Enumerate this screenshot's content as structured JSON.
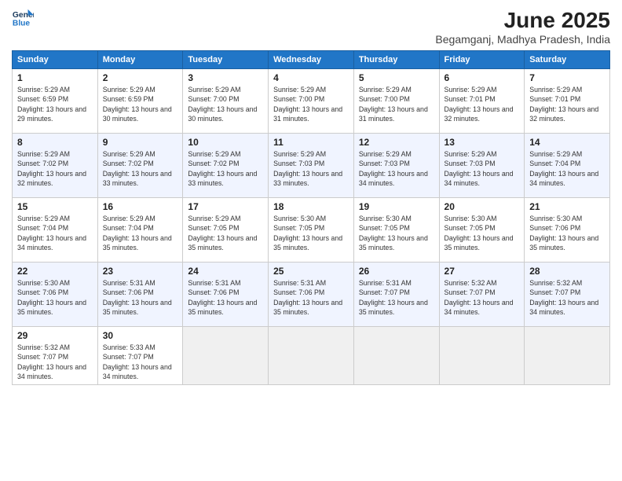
{
  "logo": {
    "line1": "General",
    "line2": "Blue"
  },
  "title": "June 2025",
  "subtitle": "Begamganj, Madhya Pradesh, India",
  "days_of_week": [
    "Sunday",
    "Monday",
    "Tuesday",
    "Wednesday",
    "Thursday",
    "Friday",
    "Saturday"
  ],
  "cells": [
    {
      "day": "",
      "empty": true
    },
    {
      "day": "",
      "empty": true
    },
    {
      "day": "",
      "empty": true
    },
    {
      "day": "",
      "empty": true
    },
    {
      "day": "",
      "empty": true
    },
    {
      "day": "",
      "empty": true
    },
    {
      "day": "7",
      "sunrise": "5:29 AM",
      "sunset": "7:01 PM",
      "daylight": "13 hours and 32 minutes."
    },
    {
      "day": "1",
      "sunrise": "5:29 AM",
      "sunset": "6:59 PM",
      "daylight": "13 hours and 29 minutes."
    },
    {
      "day": "2",
      "sunrise": "5:29 AM",
      "sunset": "6:59 PM",
      "daylight": "13 hours and 30 minutes."
    },
    {
      "day": "3",
      "sunrise": "5:29 AM",
      "sunset": "7:00 PM",
      "daylight": "13 hours and 30 minutes."
    },
    {
      "day": "4",
      "sunrise": "5:29 AM",
      "sunset": "7:00 PM",
      "daylight": "13 hours and 31 minutes."
    },
    {
      "day": "5",
      "sunrise": "5:29 AM",
      "sunset": "7:00 PM",
      "daylight": "13 hours and 31 minutes."
    },
    {
      "day": "6",
      "sunrise": "5:29 AM",
      "sunset": "7:01 PM",
      "daylight": "13 hours and 32 minutes."
    },
    {
      "day": "7",
      "sunrise": "5:29 AM",
      "sunset": "7:01 PM",
      "daylight": "13 hours and 32 minutes."
    },
    {
      "day": "8",
      "sunrise": "5:29 AM",
      "sunset": "7:02 PM",
      "daylight": "13 hours and 32 minutes."
    },
    {
      "day": "9",
      "sunrise": "5:29 AM",
      "sunset": "7:02 PM",
      "daylight": "13 hours and 33 minutes."
    },
    {
      "day": "10",
      "sunrise": "5:29 AM",
      "sunset": "7:02 PM",
      "daylight": "13 hours and 33 minutes."
    },
    {
      "day": "11",
      "sunrise": "5:29 AM",
      "sunset": "7:03 PM",
      "daylight": "13 hours and 33 minutes."
    },
    {
      "day": "12",
      "sunrise": "5:29 AM",
      "sunset": "7:03 PM",
      "daylight": "13 hours and 34 minutes."
    },
    {
      "day": "13",
      "sunrise": "5:29 AM",
      "sunset": "7:03 PM",
      "daylight": "13 hours and 34 minutes."
    },
    {
      "day": "14",
      "sunrise": "5:29 AM",
      "sunset": "7:04 PM",
      "daylight": "13 hours and 34 minutes."
    },
    {
      "day": "15",
      "sunrise": "5:29 AM",
      "sunset": "7:04 PM",
      "daylight": "13 hours and 34 minutes."
    },
    {
      "day": "16",
      "sunrise": "5:29 AM",
      "sunset": "7:04 PM",
      "daylight": "13 hours and 35 minutes."
    },
    {
      "day": "17",
      "sunrise": "5:29 AM",
      "sunset": "7:05 PM",
      "daylight": "13 hours and 35 minutes."
    },
    {
      "day": "18",
      "sunrise": "5:30 AM",
      "sunset": "7:05 PM",
      "daylight": "13 hours and 35 minutes."
    },
    {
      "day": "19",
      "sunrise": "5:30 AM",
      "sunset": "7:05 PM",
      "daylight": "13 hours and 35 minutes."
    },
    {
      "day": "20",
      "sunrise": "5:30 AM",
      "sunset": "7:05 PM",
      "daylight": "13 hours and 35 minutes."
    },
    {
      "day": "21",
      "sunrise": "5:30 AM",
      "sunset": "7:06 PM",
      "daylight": "13 hours and 35 minutes."
    },
    {
      "day": "22",
      "sunrise": "5:30 AM",
      "sunset": "7:06 PM",
      "daylight": "13 hours and 35 minutes."
    },
    {
      "day": "23",
      "sunrise": "5:31 AM",
      "sunset": "7:06 PM",
      "daylight": "13 hours and 35 minutes."
    },
    {
      "day": "24",
      "sunrise": "5:31 AM",
      "sunset": "7:06 PM",
      "daylight": "13 hours and 35 minutes."
    },
    {
      "day": "25",
      "sunrise": "5:31 AM",
      "sunset": "7:06 PM",
      "daylight": "13 hours and 35 minutes."
    },
    {
      "day": "26",
      "sunrise": "5:31 AM",
      "sunset": "7:07 PM",
      "daylight": "13 hours and 35 minutes."
    },
    {
      "day": "27",
      "sunrise": "5:32 AM",
      "sunset": "7:07 PM",
      "daylight": "13 hours and 34 minutes."
    },
    {
      "day": "28",
      "sunrise": "5:32 AM",
      "sunset": "7:07 PM",
      "daylight": "13 hours and 34 minutes."
    },
    {
      "day": "29",
      "sunrise": "5:32 AM",
      "sunset": "7:07 PM",
      "daylight": "13 hours and 34 minutes."
    },
    {
      "day": "30",
      "sunrise": "5:33 AM",
      "sunset": "7:07 PM",
      "daylight": "13 hours and 34 minutes."
    },
    {
      "day": "",
      "empty": true
    },
    {
      "day": "",
      "empty": true
    },
    {
      "day": "",
      "empty": true
    },
    {
      "day": "",
      "empty": true
    },
    {
      "day": "",
      "empty": true
    }
  ]
}
